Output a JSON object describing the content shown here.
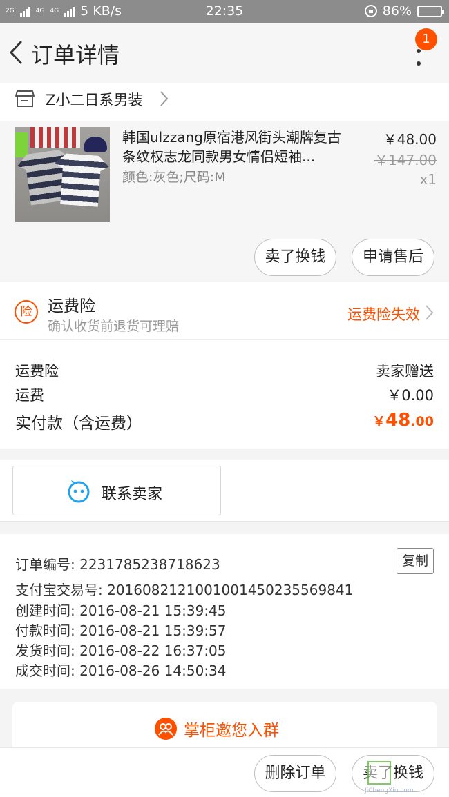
{
  "status_bar": {
    "net_2g": "2G",
    "net_4g": "4G",
    "net_4g_b": "4G",
    "speed": "5 KB/s",
    "time": "22:35",
    "battery_text": "86%",
    "battery_level": 0.86,
    "battery_color": "#2dcf3c"
  },
  "nav": {
    "title": "订单详情",
    "badge": "1",
    "icons": [
      "back-icon",
      "more-icon"
    ]
  },
  "shop": {
    "name": "Z小二日系男装"
  },
  "product": {
    "title": "韩国ulzzang原宿港风街头潮牌复古条纹权志龙同款男女情侣短袖...",
    "sku": "颜色:灰色;尺码:M",
    "price": "￥48.00",
    "original_price": "￥147.00",
    "quantity": "x1",
    "btn_sell": "卖了换钱",
    "btn_aftersale": "申请售后"
  },
  "insurance": {
    "icon_text": "险",
    "title": "运费险",
    "subtitle": "确认收货前退货可理赔",
    "status": "运费险失效"
  },
  "fees": {
    "insurance_label": "运费险",
    "insurance_value": "卖家赠送",
    "shipping_label": "运费",
    "shipping_value": "￥0.00",
    "total_label": "实付款（含运费）",
    "total_currency": "￥",
    "total_int": "48",
    "total_dec": ".00"
  },
  "contact": {
    "label": "联系卖家"
  },
  "order": {
    "number": "订单编号: 2231785238718623",
    "alipay": "支付宝交易号: 2016082121001001450235569841",
    "created": "创建时间: 2016-08-21 15:39:45",
    "paid": "付款时间: 2016-08-21 15:39:57",
    "shipped": "发货时间: 2016-08-22 16:37:05",
    "completed": "成交时间: 2016-08-26 14:50:34",
    "copy_label": "复制"
  },
  "group": {
    "label": "掌柜邀您入群"
  },
  "bottom": {
    "btn_delete": "删除订单",
    "btn_sell": "卖了换钱"
  },
  "watermark": {
    "url": "JiChengXin.com"
  },
  "colors": {
    "accent": "#ff5000",
    "status_bar": "#8c8c8c",
    "contact_icon": "#1fa3f0"
  }
}
